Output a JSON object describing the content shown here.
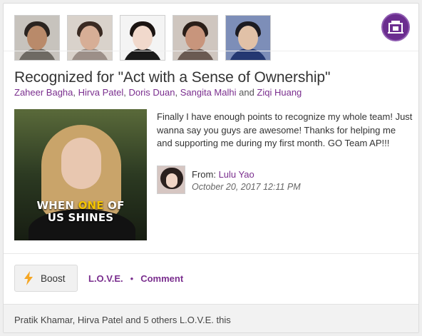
{
  "avatars": [
    {
      "name": "avatar-zaheer",
      "bg": "#c7c3bd",
      "skin": "#b98a6a",
      "hair": "#2b2420",
      "body": "#6e6a63"
    },
    {
      "name": "avatar-hirva",
      "bg": "#d9d2cb",
      "skin": "#d7ae96",
      "hair": "#3a2a22",
      "body": "#9c8f88"
    },
    {
      "name": "avatar-doris",
      "bg": "#f4f4f4",
      "skin": "#f1d9cc",
      "hair": "#1b1412",
      "body": "#1a1a1a"
    },
    {
      "name": "avatar-sangita",
      "bg": "#cfc6bf",
      "skin": "#c8957c",
      "hair": "#2a1e18",
      "body": "#6a5a52"
    },
    {
      "name": "avatar-ziqi",
      "bg": "#7d8eb8",
      "skin": "#e1c1a7",
      "hair": "#1c1b22",
      "body": "#243872"
    }
  ],
  "title": "Recognized for \"Act with a Sense of Ownership\"",
  "recipients": {
    "r1": "Zaheer Bagha",
    "r2": "Hirva Patel",
    "r3": "Doris Duan",
    "r4": "Sangita Malhi",
    "r5": "Ziqi Huang",
    "sep": ", ",
    "and": " and "
  },
  "media": {
    "caption_line1_pre": "WHEN ",
    "caption_line1_hl": "ONE",
    "caption_line1_post": " OF",
    "caption_line2": "US SHINES"
  },
  "message": "Finally I have enough points to recognize my whole team! Just wanna say you guys are awesome! Thanks for helping me and supporting me during my first month. GO Team AP!!!",
  "sender": {
    "from_label": "From: ",
    "name": "Lulu Yao",
    "date": "October 20, 2017 12:11 PM"
  },
  "actions": {
    "boost_label": "Boost",
    "love_label": "L.O.V.E.",
    "separator": "•",
    "comment_label": "Comment"
  },
  "footer_text": "Pratik Khamar, Hirva Patel and 5 others L.O.V.E. this",
  "colors": {
    "accent": "#7a2e8e",
    "badge": "#6b2d8f",
    "bolt": "#f5a623"
  }
}
